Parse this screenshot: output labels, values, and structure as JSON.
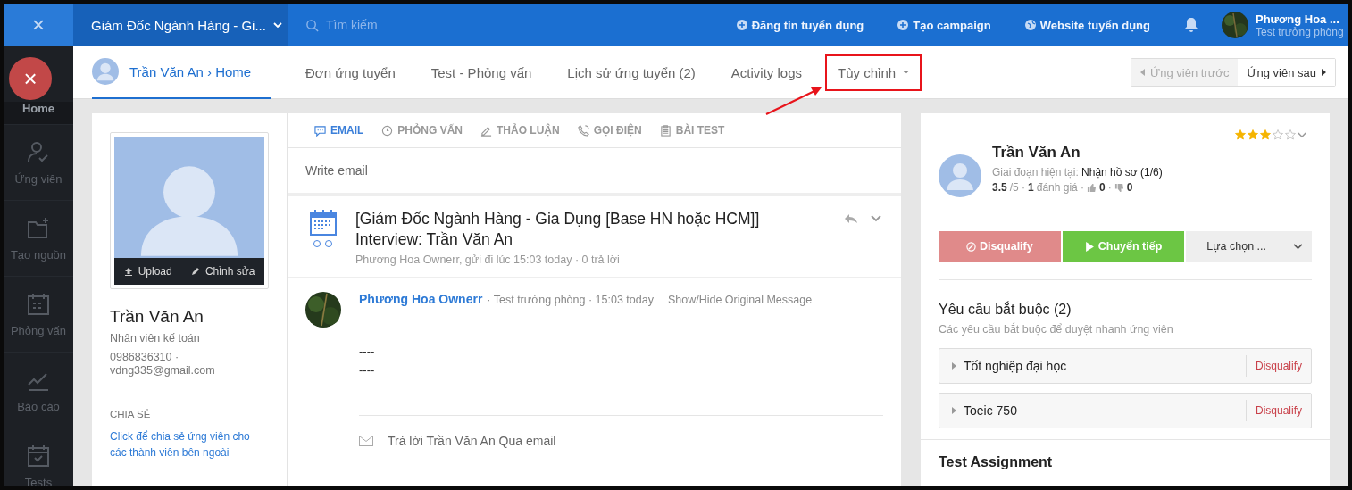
{
  "topbar": {
    "close": "×",
    "job_title": "Giám Đốc Ngành Hàng - Gi...",
    "search": {
      "placeholder": "Tìm kiếm"
    },
    "actions": [
      {
        "label": "Đăng tin tuyển dụng",
        "kind": "plus"
      },
      {
        "label": "Tạo campaign",
        "kind": "plus"
      },
      {
        "label": "Website tuyển dụng",
        "kind": "globe"
      }
    ],
    "user": {
      "name": "Phương Hoa ...",
      "role": "Test trưởng phòng"
    }
  },
  "fab": {
    "label": "×"
  },
  "sidebar": {
    "items": [
      {
        "label": "Home",
        "selected": true
      },
      {
        "label": "Ứng viên",
        "kind": "user",
        "selected": false
      },
      {
        "label": "Tạo nguồn",
        "kind": "folder",
        "selected": false
      },
      {
        "label": "Phỏng vấn",
        "kind": "calendar",
        "selected": false
      },
      {
        "label": "Báo cáo",
        "kind": "chart",
        "selected": false
      },
      {
        "label": "Tests",
        "kind": "tests",
        "selected": false
      }
    ]
  },
  "subnav": {
    "candidate": {
      "label": "Trần Văn An › Home",
      "selected": true
    },
    "tabs": [
      {
        "label": "Đơn ứng tuyển",
        "selected": false,
        "dropdown": false,
        "highlighted": false
      },
      {
        "label": "Test - Phỏng vấn",
        "selected": false,
        "dropdown": false,
        "highlighted": false
      },
      {
        "label": "Lịch sử ứng tuyển (2)",
        "selected": false,
        "dropdown": false,
        "highlighted": false
      },
      {
        "label": "Activity logs",
        "selected": false,
        "dropdown": false,
        "highlighted": false
      },
      {
        "label": "Tùy chỉnh",
        "selected": false,
        "dropdown": true,
        "highlighted": true
      }
    ],
    "prev": {
      "label": "Ứng viên trước",
      "disabled": true
    },
    "next": {
      "label": "Ứng viên sau",
      "disabled": false
    }
  },
  "profile": {
    "upload": "Upload",
    "edit": "Chỉnh sửa",
    "name": "Trần Văn An",
    "position": "Nhân viên kế toán",
    "contact": "0986836310 · vdng335@gmail.com",
    "share_heading": "CHIA SẺ",
    "share_link": "Click để chia sẻ ứng viên cho các thành viên bên ngoài"
  },
  "activity": {
    "tabs": [
      {
        "label": "EMAIL",
        "kind": "chat",
        "selected": true
      },
      {
        "label": "PHỎNG VẤN",
        "kind": "clock",
        "selected": false
      },
      {
        "label": "THẢO LUẬN",
        "kind": "pen",
        "selected": false
      },
      {
        "label": "GỌI ĐIỆN",
        "kind": "phone",
        "selected": false
      },
      {
        "label": "BÀI TEST",
        "kind": "clipboard",
        "selected": false
      }
    ],
    "compose": {
      "placeholder": "Write email"
    },
    "thread": {
      "subject": "[Giám Đốc Ngành Hàng - Gia Dụng [Base HN hoặc HCM]] Interview: Trần Văn An",
      "meta": "Phương Hoa Ownerr, gửi đi lúc 15:03 today · 0 trả lời"
    },
    "message": {
      "sender": "Phương Hoa Ownerr",
      "meta": "· Test trưởng phòng · 15:03 today",
      "toggle": "Show/Hide Original Message",
      "body": [
        "----",
        "----"
      ]
    },
    "reply": "Trả lời Trần Văn An Qua email"
  },
  "summary": {
    "stars": 3,
    "name": "Trần Văn An",
    "stage_label": "Giai đoạn hiện tại:",
    "stage": "Nhận hồ sơ (1/6)",
    "score": "3.5",
    "score_max": "/5 ·",
    "reviews": "1",
    "reviews_label": "đánh giá ·",
    "likes": "0",
    "separator": "·",
    "dislikes": "0",
    "buttons": {
      "disqualify": "Disqualify",
      "forward": "Chuyển tiếp",
      "choose": "Lựa chọn ..."
    },
    "requirements": {
      "heading": "Yêu cầu bắt buộc (2)",
      "description": "Các yêu cầu bắt buộc để duyệt nhanh ứng viên",
      "items": [
        {
          "label": "Tốt nghiệp đại học",
          "action": "Disqualify"
        },
        {
          "label": "Toeic 750",
          "action": "Disqualify"
        }
      ]
    },
    "test_heading": "Test Assignment"
  }
}
